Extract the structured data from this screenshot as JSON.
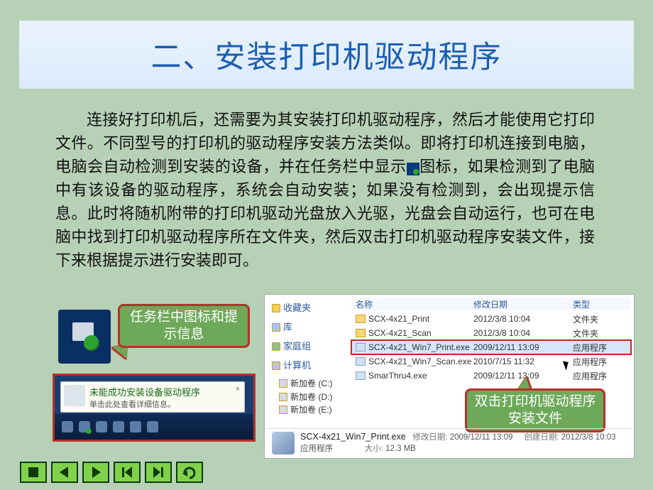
{
  "title": "二、安装打印机驱动程序",
  "body_before_icon": "连接好打印机后，还需要为其安装打印机驱动程序，然后才能使用它打印文件。不同型号的打印机的驱动程序安装方法类似。即将打印机连接到电脑，电脑会自动检测到安装的设备，并在任务栏中显示",
  "body_after_icon": "图标，如果检测到了电脑中有该设备的驱动程序，系统会自动安装；如果没有检测到，会出现提示信息。此时将随机附带的打印机驱动光盘放入光驱，光盘会自动运行，也可在电脑中找到打印机驱动程序所在文件夹，然后双击打印机驱动程序安装文件，接下来根据提示进行安装即可。",
  "callouts": {
    "left": "任务栏中图标和提示信息",
    "right": "双击打印机驱动程序安装文件"
  },
  "tooltip": {
    "title": "未能成功安装设备驱动程序",
    "sub": "单击此处查看详细信息。",
    "close": "×"
  },
  "explorer": {
    "columns": {
      "name": "名称",
      "date": "修改日期",
      "type": "类型"
    },
    "nav": {
      "favorites": "收藏夹",
      "libraries": "库",
      "homegroup": "家庭组",
      "computer": "计算机",
      "drives": [
        "新加卷 (C:)",
        "新加卷 (D:)",
        "新加卷 (E:)"
      ]
    },
    "rows": [
      {
        "name": "SCX-4x21_Print",
        "date": "2012/3/8 10:04",
        "type": "文件夹",
        "kind": "folder"
      },
      {
        "name": "SCX-4x21_Scan",
        "date": "2012/3/8 10:04",
        "type": "文件夹",
        "kind": "folder"
      },
      {
        "name": "SCX-4x21_Win7_Print.exe",
        "date": "2009/12/11 13:09",
        "type": "应用程序",
        "kind": "exe",
        "selected": true
      },
      {
        "name": "SCX-4x21_Win7_Scan.exe",
        "date": "2010/7/15 11:32",
        "type": "应用程序",
        "kind": "exe"
      },
      {
        "name": "SmarThru4.exe",
        "date": "2009/12/11 13:09",
        "type": "应用程序",
        "kind": "exe"
      }
    ],
    "detail": {
      "filename": "SCX-4x21_Win7_Print.exe",
      "modlabel": "修改日期:",
      "moddate": "2009/12/11 13:09",
      "createdlabel": "创建日期:",
      "created": "2012/3/8 10:03",
      "apptype": "应用程序",
      "sizelabel": "大小:",
      "size": "12.3 MB"
    }
  },
  "nav_icons": [
    "stop",
    "prev",
    "next",
    "first",
    "last",
    "return"
  ]
}
